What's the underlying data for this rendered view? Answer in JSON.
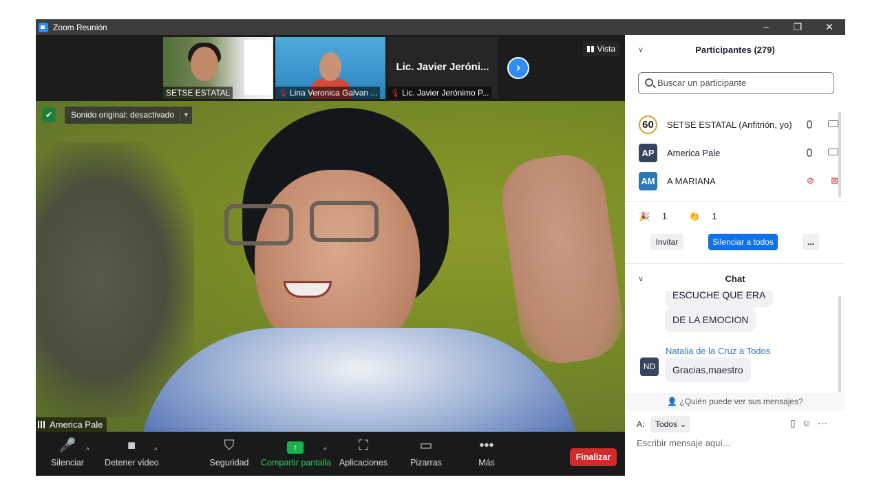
{
  "window": {
    "title": "Zoom Reunión",
    "controls": [
      "–",
      "❐",
      "✕"
    ]
  },
  "thumbnails": [
    {
      "name": "SETSE ESTATAL",
      "muted": false
    },
    {
      "name": "Lina Veronica Galvan ...",
      "muted": true
    },
    {
      "name": "Lic. Javier Jerónimo P...",
      "big_name": "Lic. Javier Jeróni...",
      "muted": true
    }
  ],
  "view_button": "Vista",
  "main_video": {
    "audio_label": "Sonido original: desactivado",
    "speaker_name": "America Pale"
  },
  "toolbar": {
    "mute": "Silenciar",
    "video": "Detener vídeo",
    "security": "Seguridad",
    "share": "Compartir pantalla",
    "apps": "Aplicaciones",
    "whiteboards": "Pizarras",
    "more": "Más",
    "end": "Finalizar"
  },
  "participants": {
    "title": "Participantes (279)",
    "search_placeholder": "Buscar un participante",
    "list": [
      {
        "avatar": "60",
        "name": "SETSE ESTATAL (Anfitrión, yo)",
        "mic_muted": false,
        "video_off": false
      },
      {
        "avatar": "AP",
        "name": "America Pale",
        "mic_muted": false,
        "video_off": false
      },
      {
        "avatar": "AM",
        "name": "A MARIANA",
        "mic_muted": true,
        "video_off": true
      }
    ],
    "reactions": [
      {
        "emoji": "🎉",
        "count": "1"
      },
      {
        "emoji": "👏",
        "count": "1"
      }
    ],
    "invite": "Invitar",
    "mute_all": "Silenciar a todos",
    "more": "..."
  },
  "chat": {
    "title": "Chat",
    "messages": [
      {
        "text": "ESCUCHE QUE ERA"
      },
      {
        "text": "DE LA EMOCION"
      },
      {
        "sender": "Natalia de la Cruz a Todos",
        "avatar": "ND",
        "text": "Gracias,maestro"
      }
    ],
    "who_can_see": "¿Quién puede ver sus mensajes?",
    "to_label": "A:",
    "recipient": "Todos",
    "input_placeholder": "Escribir mensaje aquí..."
  },
  "colors": {
    "zoom_blue": "#0e72ed",
    "end_red": "#d52a2a",
    "share_green": "#17b24c"
  }
}
